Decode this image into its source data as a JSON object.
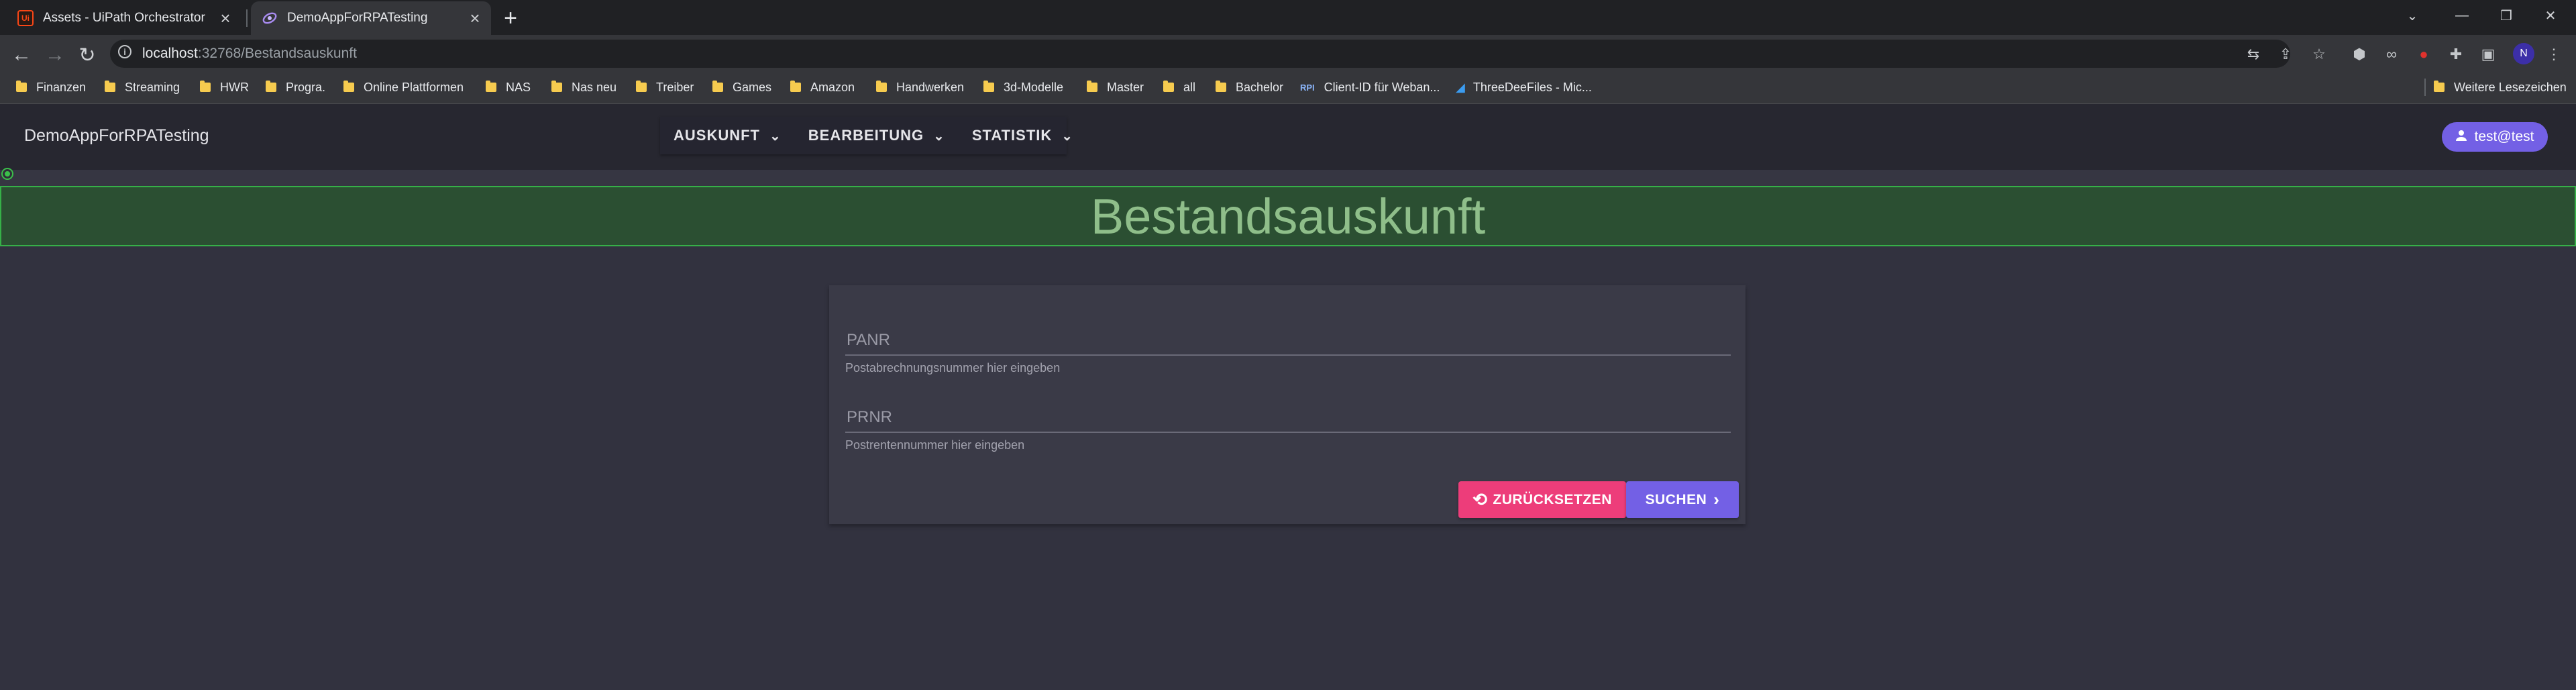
{
  "browser": {
    "tabs": [
      {
        "title": "Assets - UiPath Orchestrator",
        "favicon": "Ui",
        "active": false
      },
      {
        "title": "DemoAppForRPATesting",
        "favicon": "blazor",
        "active": true
      }
    ],
    "new_tab": "+",
    "url_host": "localhost",
    "url_rest": ":32768/Bestandsauskunft",
    "profile_initial": "N",
    "bookmarks": [
      {
        "label": "Finanzen",
        "icon": "folder"
      },
      {
        "label": "Streaming",
        "icon": "folder"
      },
      {
        "label": "HWR",
        "icon": "folder"
      },
      {
        "label": "Progra.",
        "icon": "folder"
      },
      {
        "label": "Online Plattformen",
        "icon": "folder"
      },
      {
        "label": "NAS",
        "icon": "folder"
      },
      {
        "label": "Nas neu",
        "icon": "folder"
      },
      {
        "label": "Treiber",
        "icon": "folder"
      },
      {
        "label": "Games",
        "icon": "folder"
      },
      {
        "label": "Amazon",
        "icon": "folder"
      },
      {
        "label": "Handwerken",
        "icon": "folder"
      },
      {
        "label": "3d-Modelle",
        "icon": "folder"
      },
      {
        "label": "Master",
        "icon": "folder"
      },
      {
        "label": "all",
        "icon": "folder"
      },
      {
        "label": "Bachelor",
        "icon": "folder"
      },
      {
        "label": "Client-ID für Weban...",
        "icon": "rpi",
        "icon_text": "RPI"
      },
      {
        "label": "ThreeDeeFiles - Mic...",
        "icon": "azure"
      }
    ],
    "other_bookmarks": "Weitere Lesezeichen"
  },
  "app": {
    "title": "DemoAppForRPATesting",
    "menu": [
      "AUSKUNFT",
      "BEARBEITUNG",
      "STATISTIK"
    ],
    "user": "test@test",
    "accent_color": "#7360e5",
    "reset_color": "#ed3d7a",
    "banner_color": "#2b4f32"
  },
  "page": {
    "heading": "Bestandsauskunft",
    "fields": [
      {
        "label": "PANR",
        "hint": "Postabrechnungsnummer hier eingeben",
        "value": ""
      },
      {
        "label": "PRNR",
        "hint": "Postrentennummer hier eingeben",
        "value": ""
      }
    ],
    "reset_label": "ZURÜCKSETZEN",
    "search_label": "SUCHEN"
  }
}
